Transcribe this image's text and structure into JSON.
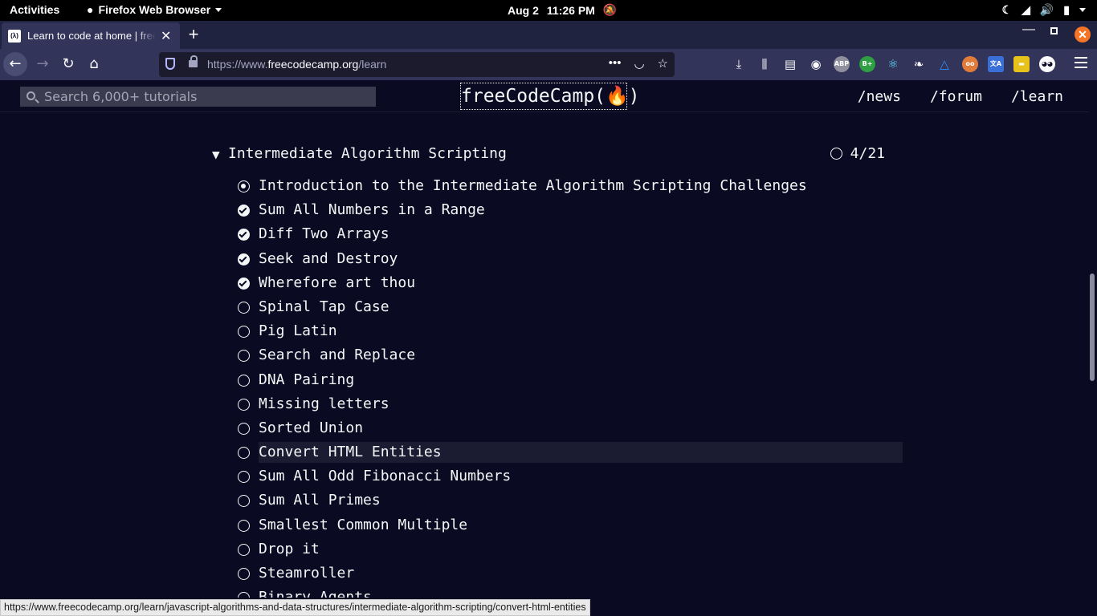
{
  "topbar": {
    "activities": "Activities",
    "app_name": "Firefox Web Browser",
    "date": "Aug 2",
    "time": "11:26 PM"
  },
  "browser": {
    "tab_title": "Learn to code at home | freeCodeCamp.org",
    "favicon_text": "(λ)",
    "url_prefix": "https://www.",
    "url_domain": "freecodecamp.org",
    "url_path": "/learn",
    "status_link": "https://www.freecodecamp.org/learn/javascript-algorithms-and-data-structures/intermediate-algorithm-scripting/convert-html-entities"
  },
  "fcc_nav": {
    "search_placeholder": "Search 6,000+ tutorials",
    "logo": "freeCodeCamp(🔥)",
    "links": [
      "/news",
      "/forum",
      "/learn"
    ]
  },
  "section": {
    "title": "Intermediate Algorithm Scripting",
    "progress": "4/21",
    "challenges": [
      {
        "label": "Introduction to the Intermediate Algorithm Scripting Challenges",
        "status": "current"
      },
      {
        "label": "Sum All Numbers in a Range",
        "status": "done"
      },
      {
        "label": "Diff Two Arrays",
        "status": "done"
      },
      {
        "label": "Seek and Destroy",
        "status": "done"
      },
      {
        "label": "Wherefore art thou",
        "status": "done"
      },
      {
        "label": "Spinal Tap Case",
        "status": "empty"
      },
      {
        "label": "Pig Latin",
        "status": "empty"
      },
      {
        "label": "Search and Replace",
        "status": "empty"
      },
      {
        "label": "DNA Pairing",
        "status": "empty"
      },
      {
        "label": "Missing letters",
        "status": "empty"
      },
      {
        "label": "Sorted Union",
        "status": "empty"
      },
      {
        "label": "Convert HTML Entities",
        "status": "empty",
        "hovered": true
      },
      {
        "label": "Sum All Odd Fibonacci Numbers",
        "status": "empty"
      },
      {
        "label": "Sum All Primes",
        "status": "empty"
      },
      {
        "label": "Smallest Common Multiple",
        "status": "empty"
      },
      {
        "label": "Drop it",
        "status": "empty"
      },
      {
        "label": "Steamroller",
        "status": "empty"
      },
      {
        "label": "Binary Agents",
        "status": "empty"
      }
    ]
  },
  "colors": {
    "page_bg": "#0a0a23",
    "text": "#f5f6f7",
    "hover_bg": "#1b1b32",
    "search_bg": "#3b3b4f",
    "toolbar_bg": "#32345a"
  }
}
